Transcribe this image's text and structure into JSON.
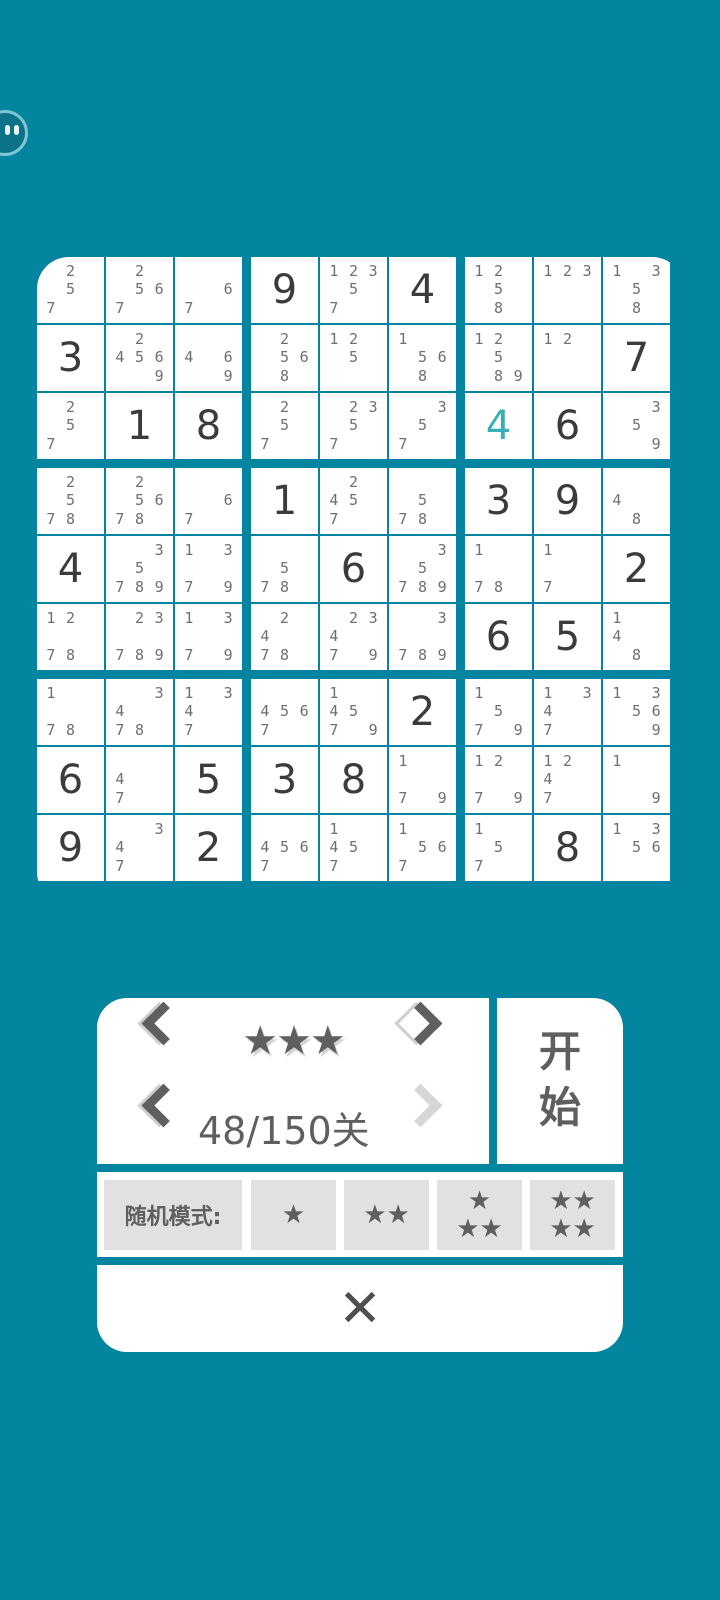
{
  "board": [
    [
      {
        "n": "257"
      },
      {
        "n": "2567"
      },
      {
        "n": "67"
      },
      {
        "v": "9"
      },
      {
        "n": "12357"
      },
      {
        "v": "4"
      },
      {
        "n": "1258"
      },
      {
        "n": "123"
      },
      {
        "n": "1358"
      }
    ],
    [
      {
        "v": "3"
      },
      {
        "n": "24569"
      },
      {
        "n": "469"
      },
      {
        "n": "2568"
      },
      {
        "n": "125"
      },
      {
        "n": "1568"
      },
      {
        "n": "12589"
      },
      {
        "n": "12"
      },
      {
        "v": "7"
      }
    ],
    [
      {
        "n": "257"
      },
      {
        "v": "1"
      },
      {
        "v": "8"
      },
      {
        "n": "257"
      },
      {
        "n": "2357"
      },
      {
        "n": "357"
      },
      {
        "v": "4",
        "user": true
      },
      {
        "v": "6"
      },
      {
        "n": "359"
      }
    ],
    [
      {
        "n": "2578"
      },
      {
        "n": "25678"
      },
      {
        "n": "67"
      },
      {
        "v": "1"
      },
      {
        "n": "2457"
      },
      {
        "n": "578"
      },
      {
        "v": "3"
      },
      {
        "v": "9"
      },
      {
        "n": "48"
      }
    ],
    [
      {
        "v": "4"
      },
      {
        "n": "35789"
      },
      {
        "n": "1379"
      },
      {
        "n": "578"
      },
      {
        "v": "6"
      },
      {
        "n": "35789"
      },
      {
        "n": "178"
      },
      {
        "n": "17"
      },
      {
        "v": "2"
      }
    ],
    [
      {
        "n": "1278"
      },
      {
        "n": "23789"
      },
      {
        "n": "1379"
      },
      {
        "n": "2478"
      },
      {
        "n": "23479"
      },
      {
        "n": "3789"
      },
      {
        "v": "6"
      },
      {
        "v": "5"
      },
      {
        "n": "148"
      }
    ],
    [
      {
        "n": "178"
      },
      {
        "n": "3478"
      },
      {
        "n": "1347"
      },
      {
        "n": "4567"
      },
      {
        "n": "14579"
      },
      {
        "v": "2"
      },
      {
        "n": "1579"
      },
      {
        "n": "1347"
      },
      {
        "n": "13569"
      }
    ],
    [
      {
        "v": "6"
      },
      {
        "n": "47"
      },
      {
        "v": "5"
      },
      {
        "v": "3"
      },
      {
        "v": "8"
      },
      {
        "n": "179"
      },
      {
        "n": "1279"
      },
      {
        "n": "1247"
      },
      {
        "n": "19"
      }
    ],
    [
      {
        "v": "9"
      },
      {
        "n": "347"
      },
      {
        "v": "2"
      },
      {
        "n": "4567"
      },
      {
        "n": "1457"
      },
      {
        "n": "1567"
      },
      {
        "n": "157"
      },
      {
        "v": "8"
      },
      {
        "n": "1356"
      }
    ]
  ],
  "level": {
    "difficulty_stars": "★★★",
    "counter": "48/150关"
  },
  "start": {
    "line1": "开",
    "line2": "始"
  },
  "random_mode": {
    "label": "随机模式:",
    "options": [
      {
        "rows": [
          "★"
        ]
      },
      {
        "rows": [
          "★★"
        ]
      },
      {
        "rows": [
          "★",
          "★★"
        ]
      },
      {
        "rows": [
          "★★",
          "★★"
        ]
      }
    ]
  },
  "close": {
    "label": "✕"
  },
  "colors": {
    "background": "#03849f",
    "digit": "#3b3b3b",
    "user_digit": "#3aaeb8",
    "note": "#6f6f6f"
  }
}
